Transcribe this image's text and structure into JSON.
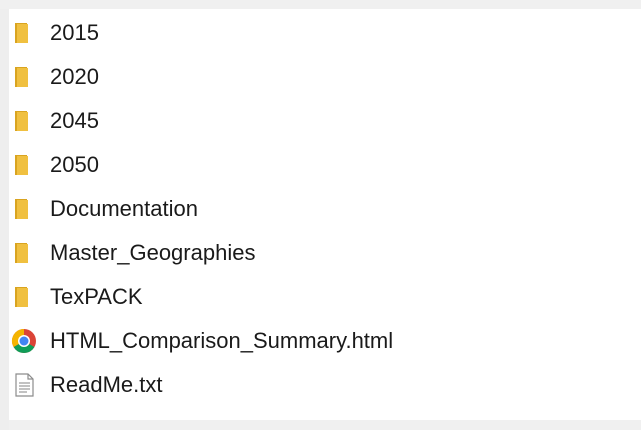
{
  "files": [
    {
      "name": "2015",
      "icon": "folder-icon"
    },
    {
      "name": "2020",
      "icon": "folder-icon"
    },
    {
      "name": "2045",
      "icon": "folder-icon"
    },
    {
      "name": "2050",
      "icon": "folder-icon"
    },
    {
      "name": "Documentation",
      "icon": "folder-icon"
    },
    {
      "name": "Master_Geographies",
      "icon": "folder-icon"
    },
    {
      "name": "TexPACK",
      "icon": "folder-icon"
    },
    {
      "name": "HTML_Comparison_Summary.html",
      "icon": "chrome-icon"
    },
    {
      "name": "ReadMe.txt",
      "icon": "text-file-icon"
    }
  ],
  "colors": {
    "folder": "#f0c040",
    "folder_dark": "#d9a420",
    "text": "#1a1a1a"
  }
}
